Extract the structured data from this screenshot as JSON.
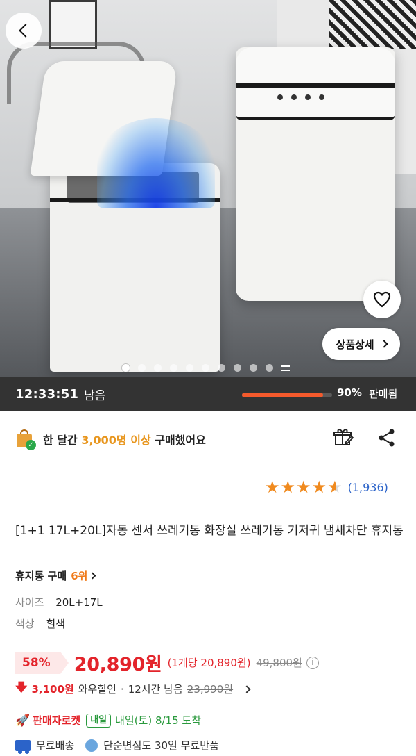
{
  "gallery": {
    "total_images": 10,
    "current_index": 1,
    "detail_button_label": "상품상세"
  },
  "timer": {
    "time": "12:33:51",
    "remain_label": "남음",
    "sold_percent": 90,
    "sold_percent_label": "90%",
    "sold_label": "판매됨",
    "colors": {
      "bar_bg": "#333333",
      "fill": "#f55a2c"
    }
  },
  "social_proof": {
    "prefix": "한 달간",
    "count": "3,000명 이상",
    "suffix": "구매했어요"
  },
  "rating": {
    "stars": 4.5,
    "count": "(1,936)"
  },
  "product": {
    "title": "[1+1 17L+20L]자동 센서 쓰레기통 화장실 쓰레기통 기저귀 냄새차단 휴지통",
    "rank_category": "휴지통 구매",
    "rank": "6위",
    "options": [
      {
        "key": "사이즈",
        "value": "20L+17L"
      },
      {
        "key": "색상",
        "value": "흰색"
      }
    ]
  },
  "price": {
    "discount": "58%",
    "sale_price": "20,890원",
    "unit_price": "(1개당 20,890원)",
    "original_price": "49,800원",
    "wow_arrow": "🡇",
    "wow_amount": "3,100원",
    "wow_label": "와우할인",
    "wow_separator": "·",
    "wow_time": "12시간 남음",
    "wow_original": "23,990원",
    "accent_color": "#e3242b"
  },
  "delivery": {
    "rocket_label": "판매자로켓",
    "badge": "내일",
    "arrival": "내일(토) 8/15 도착"
  },
  "perks": {
    "shipping": "무료배송",
    "returns": "단순변심도 30일 무료반품"
  },
  "icons": {
    "back": "chevron-left-icon",
    "wish": "heart-icon",
    "gift": "gift-icon",
    "share": "share-icon",
    "bag": "shopping-bag-icon",
    "info": "info-icon",
    "truck": "truck-icon",
    "return": "return-icon",
    "rocket": "rocket-icon"
  }
}
